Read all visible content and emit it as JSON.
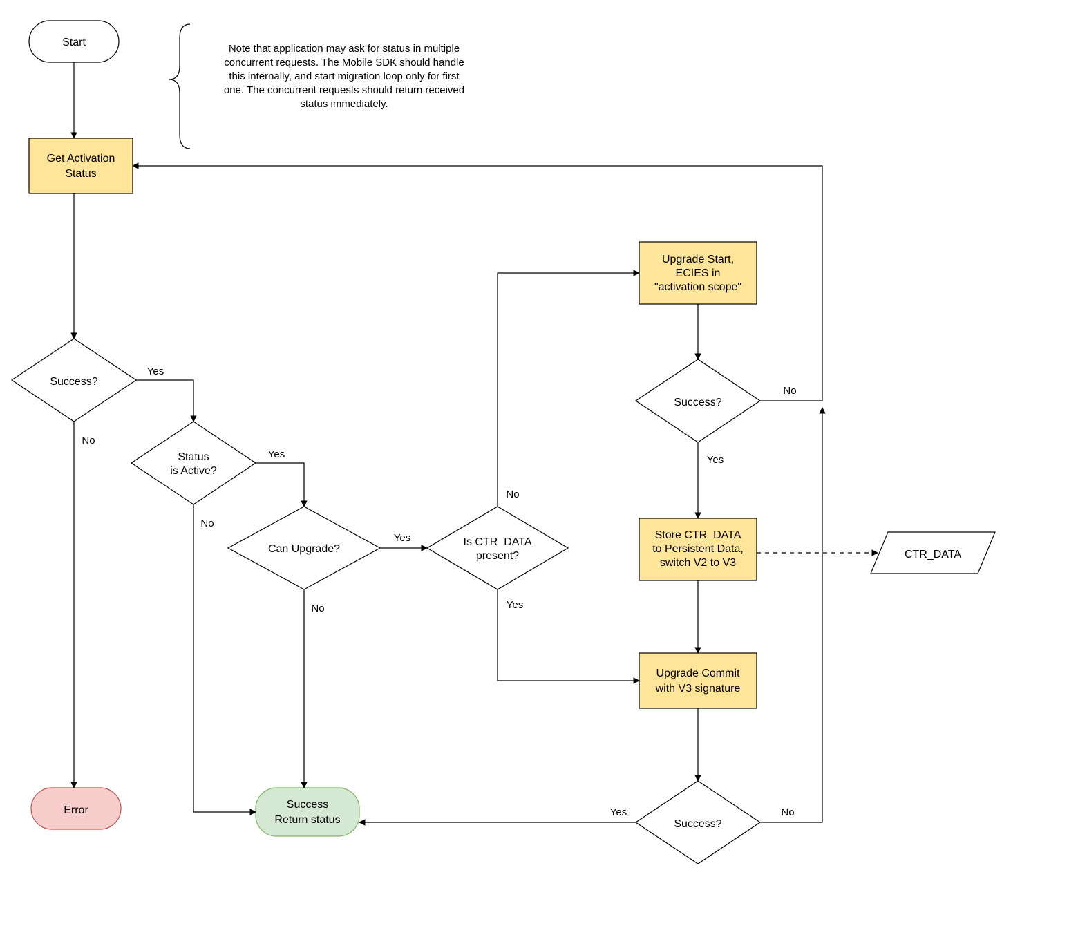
{
  "nodes": {
    "start": "Start",
    "get_activation_status": [
      "Get Activation",
      "Status"
    ],
    "success1": "Success?",
    "status_active": [
      "Status",
      "is Active?"
    ],
    "can_upgrade": "Can Upgrade?",
    "ctr_data_present": [
      "Is CTR_DATA",
      "present?"
    ],
    "upgrade_start": [
      "Upgrade Start,",
      "ECIES in",
      "\"activation scope\""
    ],
    "success2": "Success?",
    "store_ctr": [
      "Store CTR_DATA",
      "to Persistent Data,",
      "switch V2 to V3"
    ],
    "upgrade_commit": [
      "Upgrade Commit",
      "with V3 signature"
    ],
    "success3": "Success?",
    "ctr_data": "CTR_DATA",
    "error": "Error",
    "success_return": [
      "Success",
      "Return status"
    ]
  },
  "labels": {
    "yes": "Yes",
    "no": "No"
  },
  "note": [
    "Note that application may ask for status in multiple",
    "concurrent requests. The Mobile SDK should handle",
    "this internally, and start migration loop only for first",
    "one. The concurrent requests should return received",
    "status immediately."
  ]
}
